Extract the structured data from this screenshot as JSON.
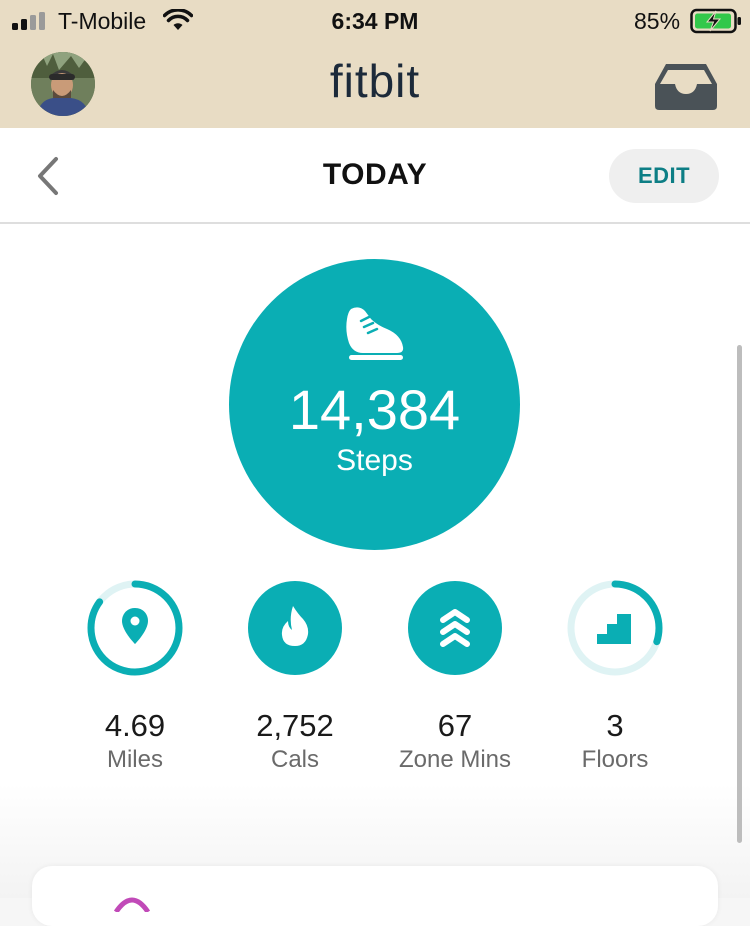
{
  "status_bar": {
    "carrier": "T-Mobile",
    "time": "6:34 PM",
    "battery_percent": "85%"
  },
  "header": {
    "logo": "fitbit",
    "avatar_icon": "user-photo",
    "inbox_icon": "inbox-icon"
  },
  "nav": {
    "title": "TODAY",
    "edit_label": "EDIT",
    "back_icon": "chevron-left-icon"
  },
  "steps": {
    "value": "14,384",
    "label": "Steps",
    "icon": "shoe-icon"
  },
  "stats": [
    {
      "value": "4.69",
      "label": "Miles",
      "icon": "location-pin-icon",
      "progress": 0.85
    },
    {
      "value": "2,752",
      "label": "Cals",
      "icon": "flame-icon",
      "progress": 1.0
    },
    {
      "value": "67",
      "label": "Zone Mins",
      "icon": "chevrons-up-icon",
      "progress": 1.0
    },
    {
      "value": "3",
      "label": "Floors",
      "icon": "stairs-icon",
      "progress": 0.3
    }
  ],
  "colors": {
    "teal": "#0aaeb4",
    "header_bg": "#e8dcc4",
    "edit_text": "#0d7e85"
  }
}
